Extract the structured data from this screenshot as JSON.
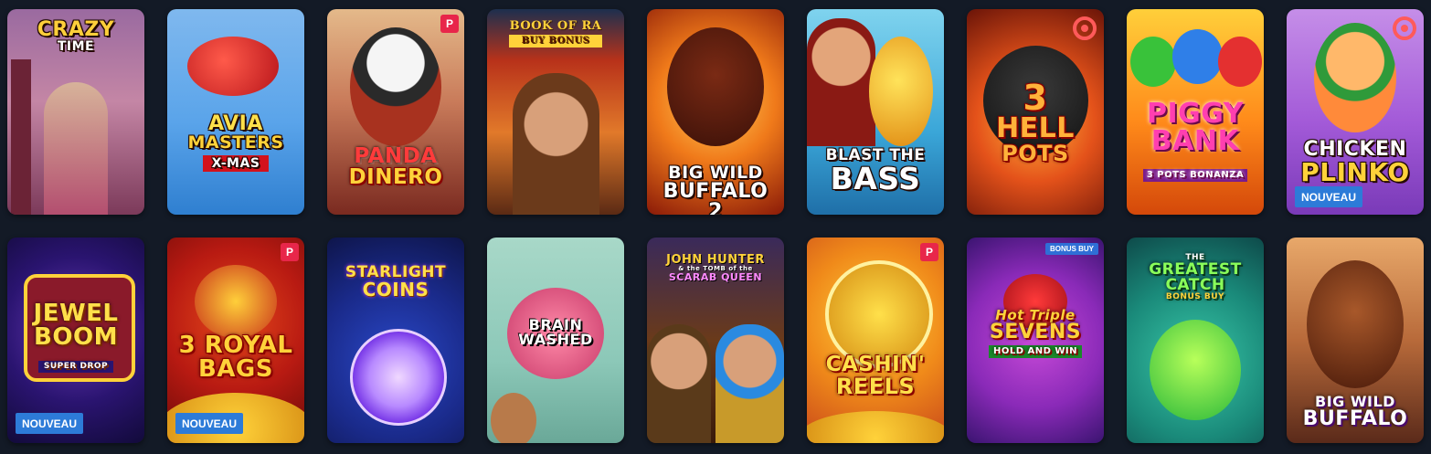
{
  "colors": {
    "page_background": "#131a26",
    "nouveau_badge": "#2d7bd8",
    "provider_badge": "#e8264a",
    "bonus_buy_badge": "#2f6fd6"
  },
  "icons": {
    "provider_badge": "p-icon",
    "target_badge": "target-icon"
  },
  "games": [
    {
      "title_lines": [
        "CRAZY",
        "TIME"
      ],
      "badge": "",
      "corner": ""
    },
    {
      "title_lines": [
        "AVIA",
        "MASTERS",
        "X-MAS"
      ],
      "badge": "",
      "corner": ""
    },
    {
      "title_lines": [
        "PANDA",
        "DINERO"
      ],
      "badge": "",
      "corner": "P"
    },
    {
      "title_lines": [
        "BOOK OF RA",
        "BUY BONUS"
      ],
      "badge": "",
      "corner": ""
    },
    {
      "title_lines": [
        "BIG WILD",
        "BUFFALO 2"
      ],
      "badge": "",
      "corner": ""
    },
    {
      "title_lines": [
        "BLAST THE",
        "BASS"
      ],
      "badge": "",
      "corner": ""
    },
    {
      "title_lines": [
        "3",
        "HELL",
        "POTS"
      ],
      "badge": "",
      "corner": "target"
    },
    {
      "title_lines": [
        "PIGGY",
        "BANK",
        "3 POTS BONANZA"
      ],
      "badge": "",
      "corner": ""
    },
    {
      "title_lines": [
        "CHICKEN",
        "PLINKO"
      ],
      "badge": "NOUVEAU",
      "corner": "target"
    },
    {
      "title_lines": [
        "JEWEL",
        "BOOM",
        "SUPER DROP"
      ],
      "badge": "NOUVEAU",
      "corner": ""
    },
    {
      "title_lines": [
        "3 ROYAL",
        "BAGS"
      ],
      "badge": "NOUVEAU",
      "corner": "P"
    },
    {
      "title_lines": [
        "STARLIGHT",
        "COINS"
      ],
      "badge": "",
      "corner": ""
    },
    {
      "title_lines": [
        "BRAIN",
        "WASHED"
      ],
      "badge": "",
      "corner": ""
    },
    {
      "title_lines": [
        "JOHN HUNTER",
        "& the TOMB of the",
        "SCARAB QUEEN"
      ],
      "badge": "",
      "corner": ""
    },
    {
      "title_lines": [
        "CASHIN'",
        "REELS"
      ],
      "badge": "",
      "corner": "P"
    },
    {
      "title_lines": [
        "Hot Triple",
        "SEVENS",
        "HOLD AND WIN"
      ],
      "badge": "",
      "corner": "BONUS BUY"
    },
    {
      "title_lines": [
        "THE",
        "GREATEST",
        "CATCH",
        "BONUS BUY"
      ],
      "badge": "",
      "corner": ""
    },
    {
      "title_lines": [
        "BIG WILD",
        "BUFFALO"
      ],
      "badge": "",
      "corner": ""
    }
  ]
}
